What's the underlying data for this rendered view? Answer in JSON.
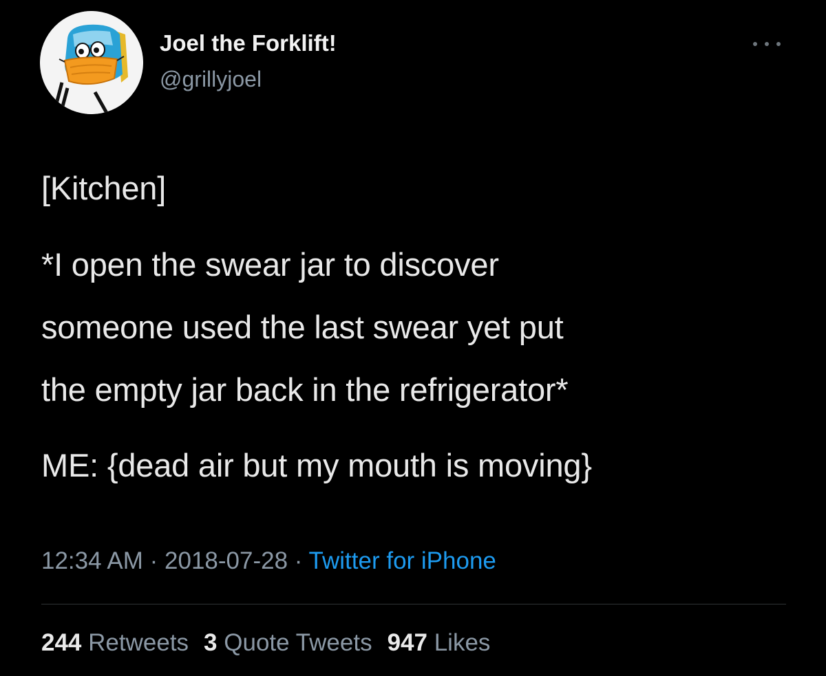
{
  "user": {
    "display_name": "Joel the Forklift!",
    "handle": "@grillyjoel",
    "avatar_icon": "forklift-character-avatar"
  },
  "tweet": {
    "lines": [
      "[Kitchen]",
      "*I open the swear jar to discover",
      "someone used the last swear yet put",
      "the empty jar back in the refrigerator*",
      "ME: {dead air but my mouth is moving}"
    ]
  },
  "meta": {
    "time": "12:34 AM",
    "separator": "·",
    "date": "2018-07-28",
    "source": "Twitter for iPhone"
  },
  "stats": {
    "retweets_count": "244",
    "retweets_label": "Retweets",
    "quotes_count": "3",
    "quotes_label": "Quote Tweets",
    "likes_count": "947",
    "likes_label": "Likes"
  },
  "colors": {
    "background": "#000000",
    "link": "#1d9bf0",
    "secondary_text": "#8b98a5",
    "avatar_mask": "#f39a1f"
  },
  "icons": {
    "more": "more-horizontal-icon"
  }
}
